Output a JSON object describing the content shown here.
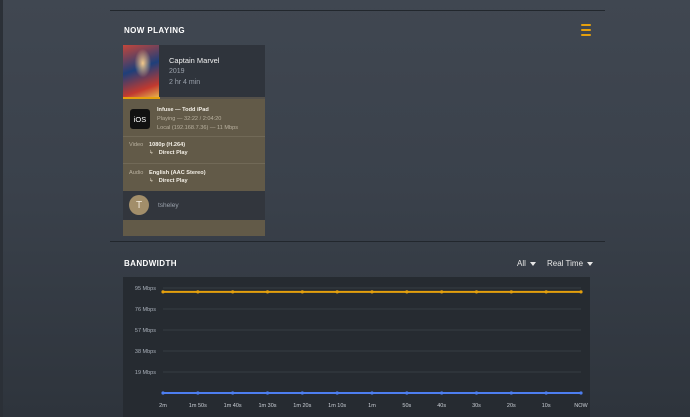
{
  "now_playing": {
    "title": "NOW PLAYING",
    "menu_icon": "list-icon",
    "session": {
      "movie_title": "Captain Marvel",
      "year": "2019",
      "duration": "2 hr 4 min",
      "progress_fraction": 0.26,
      "platform_icon_text": "iOS",
      "player_line": "Infuse — Todd iPad",
      "state_line": "Playing — 32:22 / 2:04:20",
      "location_line": "Local (192.168.7.36) — 11 Mbps",
      "video_label": "Video",
      "video_value": "1080p (H.264)",
      "video_decision": "Direct Play",
      "audio_label": "Audio",
      "audio_value": "English (AAC Stereo)",
      "audio_decision": "Direct Play",
      "user_initial": "T",
      "username": "tsheley"
    }
  },
  "bandwidth": {
    "title": "BANDWIDTH",
    "filter_label": "All",
    "range_label": "Real Time"
  },
  "colors": {
    "accent": "#e5a00d",
    "local_series": "#e5a00d",
    "remote_series": "#4d7ef0"
  },
  "chart_data": {
    "type": "line",
    "y_ticks": [
      "95 Mbps",
      "76 Mbps",
      "57 Mbps",
      "38 Mbps",
      "19 Mbps"
    ],
    "y_tick_values": [
      95,
      76,
      57,
      38,
      19
    ],
    "ylim": [
      0,
      95
    ],
    "x_ticks": [
      "2m",
      "1m 50s",
      "1m 40s",
      "1m 30s",
      "1m 20s",
      "1m 10s",
      "1m",
      "50s",
      "40s",
      "30s",
      "20s",
      "10s",
      "NOW"
    ],
    "x_values": [
      0,
      1,
      2,
      3,
      4,
      5,
      6,
      7,
      8,
      9,
      10,
      11,
      12
    ],
    "grid": true,
    "series": [
      {
        "color": "#e5a00d",
        "values": [
          91.5,
          91.5,
          91.5,
          91.5,
          91.5,
          91.5,
          91.5,
          91.5,
          91.5,
          91.5,
          91.5,
          91.5,
          91.5
        ]
      },
      {
        "color": "#4d7ef0",
        "values": [
          0,
          0,
          0,
          0,
          0,
          0,
          0,
          0,
          0,
          0,
          0,
          0,
          0
        ]
      }
    ]
  }
}
